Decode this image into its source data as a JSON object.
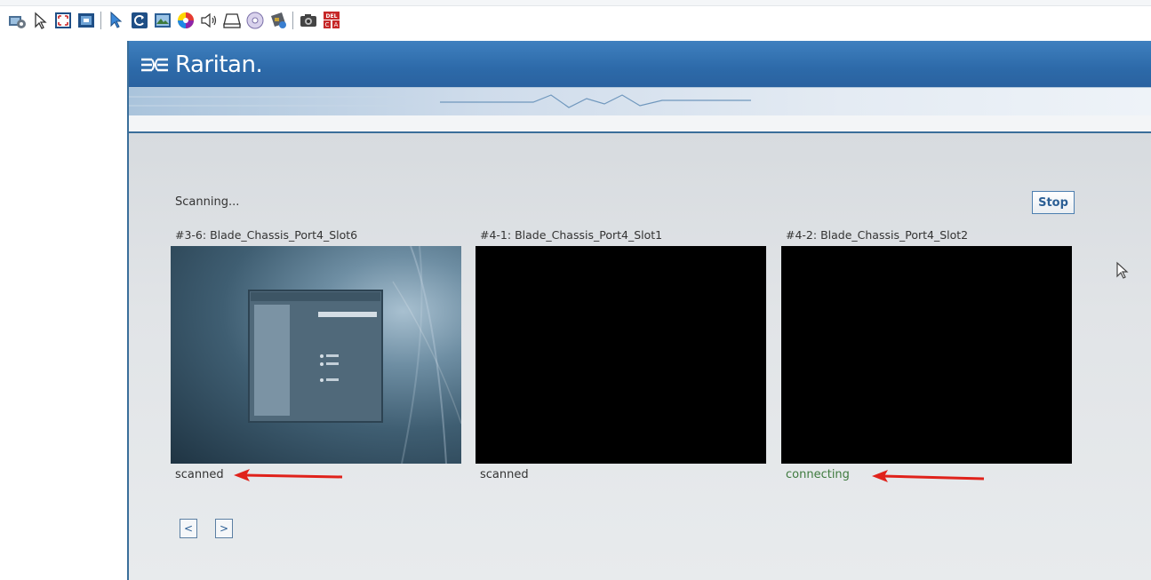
{
  "toolbar": {
    "icons": [
      "settings-gear-icon",
      "pointer-icon",
      "fit-window-icon",
      "fullscreen-icon",
      "single-cursor-icon",
      "refresh-icon",
      "video-settings-icon",
      "color-settings-icon",
      "audio-icon",
      "virtual-media-drive-icon",
      "cd-dvd-icon",
      "smart-card-icon",
      "screenshot-camera-icon",
      "ctrl-alt-del-icon"
    ]
  },
  "header": {
    "logo_text": "Raritan."
  },
  "scan": {
    "status": "Scanning...",
    "stop_label": "Stop",
    "tiles": [
      {
        "label": "#3-6: Blade_Chassis_Port4_Slot6",
        "status": "scanned",
        "preview": "desktop"
      },
      {
        "label": "#4-1: Blade_Chassis_Port4_Slot1",
        "status": "scanned",
        "preview": "black"
      },
      {
        "label": "#4-2: Blade_Chassis_Port4_Slot2",
        "status": "connecting",
        "preview": "black"
      }
    ],
    "prev_label": "<",
    "next_label": ">"
  },
  "colors": {
    "header_blue": "#2d6aa9",
    "connecting_green": "#3e7a3e",
    "annotation_arrow": "#e0221b"
  }
}
